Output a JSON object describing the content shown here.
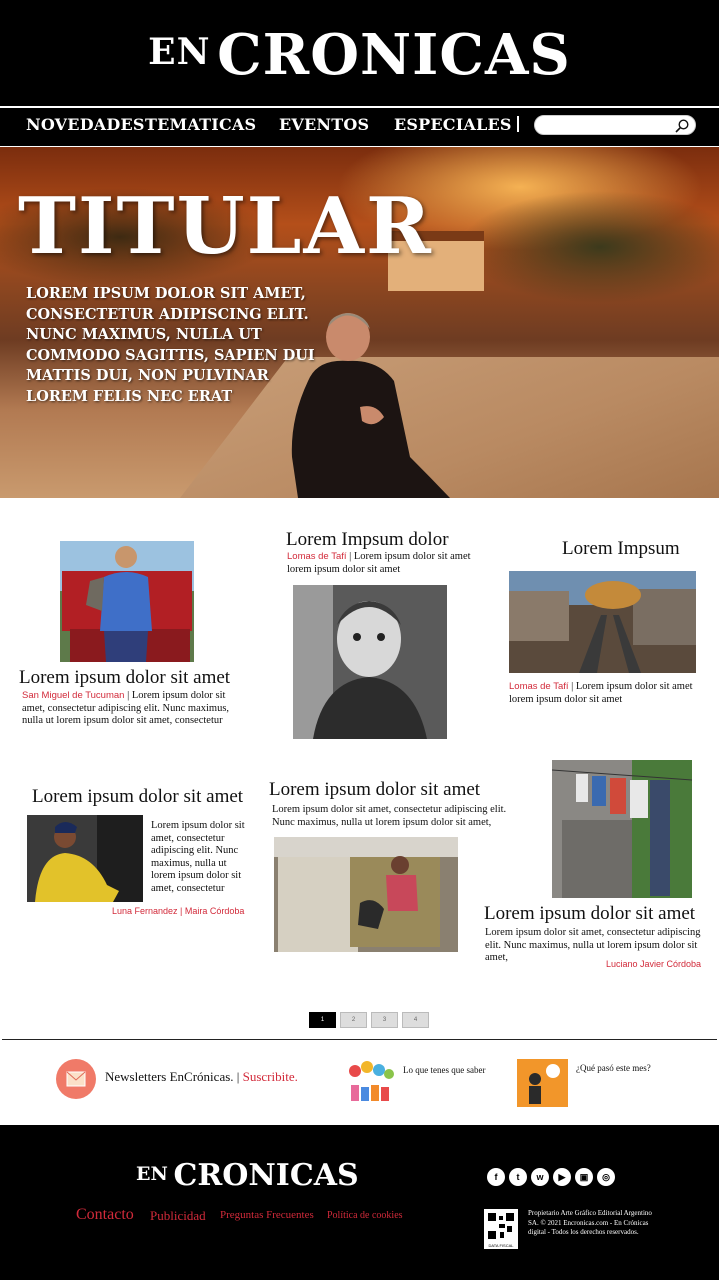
{
  "brand": {
    "en": "EN",
    "cronicas": "CRONICAS"
  },
  "nav": {
    "items": [
      "NOVEDADES",
      "TEMATICAS",
      "EVENTOS",
      "ESPECIALES"
    ],
    "search_placeholder": ""
  },
  "hero": {
    "title": "TITULAR",
    "text": "LOREM IPSUM DOLOR SIT AMET, CONSECTETUR ADIPISCING ELIT. NUNC MAXIMUS, NULLA UT COMMODO SAGITTIS, SAPIEN DUI MATTIS DUI, NON PULVINAR LOREM FELIS NEC ERAT"
  },
  "cards": {
    "c1": {
      "title": "Lorem ipsum dolor sit amet",
      "location": "San Miguel de Tucuman",
      "sep": " | ",
      "body": "Lorem ipsum dolor sit amet, consectetur adipiscing elit. Nunc maximus, nulla ut lorem ipsum dolor sit amet, consectetur"
    },
    "c2": {
      "title": "Lorem Impsum dolor",
      "location": "Lomas de Tafí",
      "sep": " | ",
      "body": "Lorem ipsum dolor sit amet lorem ipsum dolor sit amet"
    },
    "c3": {
      "title": "Lorem Impsum",
      "location": "Lomas de Tafí",
      "sep": " | ",
      "body": "Lorem ipsum dolor sit amet lorem ipsum dolor sit amet"
    },
    "c4": {
      "title": "Lorem ipsum dolor sit amet",
      "body": "Lorem ipsum dolor sit amet, consectetur adipiscing elit. Nunc maximus, nulla ut lorem ipsum dolor sit amet, consectetur",
      "credit": "Luna Fernandez | Maira Córdoba"
    },
    "c5": {
      "title": "Lorem ipsum dolor sit amet",
      "body": "Lorem ipsum dolor sit amet, consectetur adipiscing elit. Nunc maximus, nulla ut  lorem ipsum dolor sit amet,"
    },
    "c6": {
      "title": "Lorem ipsum dolor sit amet",
      "body": "Lorem ipsum dolor sit amet, consectetur adipiscing elit. Nunc maximus, nulla ut  lorem ipsum dolor sit amet,",
      "credit": "Luciano Javier Córdoba"
    }
  },
  "pagination": {
    "pages": [
      "1",
      "2",
      "3",
      "4"
    ],
    "current": "1"
  },
  "newsletter": {
    "label": "Newsletters EnCrónicas. | ",
    "cta": "Suscribite.",
    "item2": "Lo que tenes que saber",
    "item3": "¿Qué pasó este mes?"
  },
  "footer": {
    "links": [
      "Contacto",
      "Publicidad",
      "Preguntas Frecuentes",
      "Política de cookies"
    ],
    "social": [
      "facebook-icon",
      "twitter-icon",
      "whatsapp-icon",
      "youtube-icon",
      "youtube-alt-icon",
      "instagram-icon"
    ],
    "legal": "Propietario Arte Gráfico Editorial Argentino SA. © 2021 Encronicas.com - En Crónicas digital - Todos los derechos reservados.",
    "qr_label": "DATA FISCAL"
  },
  "colors": {
    "accent": "#d22a3a",
    "header_bg": "#000000"
  }
}
